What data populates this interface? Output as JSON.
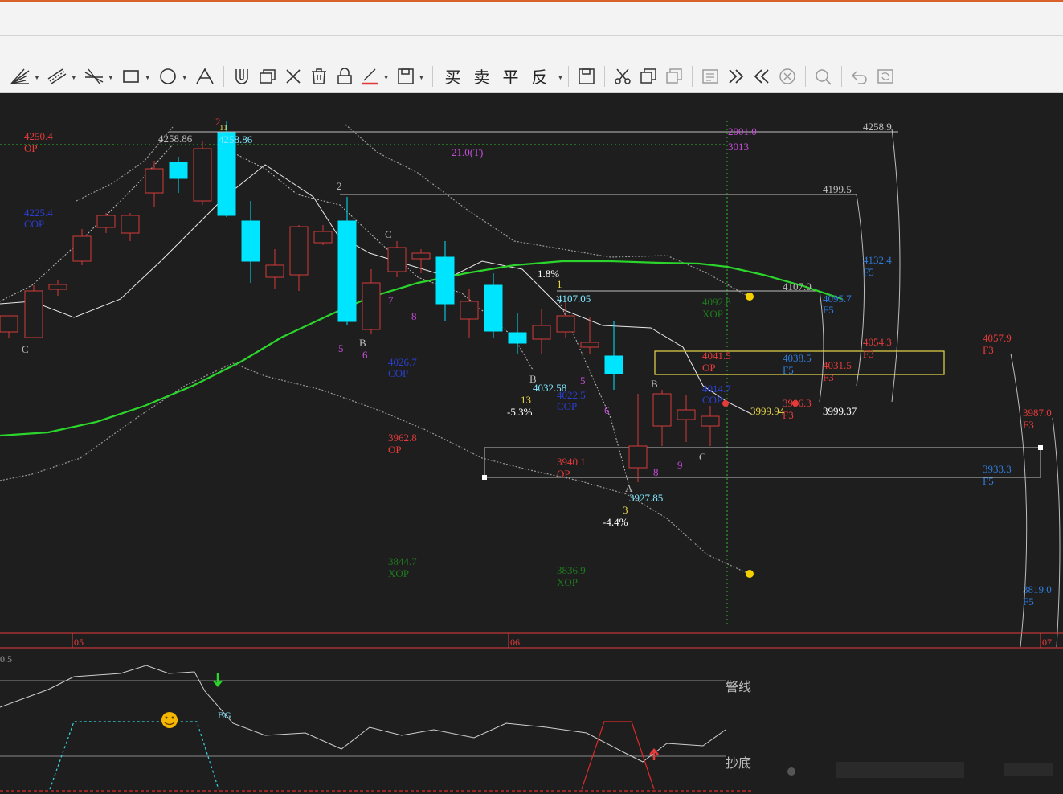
{
  "toolbar": {
    "tools": [
      {
        "name": "fan-lines-tool-icon",
        "caret": true
      },
      {
        "name": "parallel-lines-tool-icon",
        "caret": true
      },
      {
        "name": "cross-lines-tool-icon",
        "caret": true
      },
      {
        "name": "rectangle-tool-icon",
        "caret": true
      },
      {
        "name": "ellipse-tool-icon",
        "caret": true
      },
      {
        "name": "text-tool-icon",
        "caret": false
      }
    ],
    "trade_buttons": [
      "买",
      "卖",
      "平",
      "反"
    ]
  },
  "axis": {
    "x_labels": [
      "05",
      "06",
      "07"
    ]
  },
  "indicator": {
    "top_value": "0.5",
    "warning_label": "警线",
    "bottom_label": "抄底",
    "bg_label": "BG"
  },
  "price_labels": {
    "p4250": "4250.4",
    "op": "OP",
    "p4225": "4225.4",
    "cop": "COP",
    "p4258a": "4258.86",
    "p4258b": "4258.86",
    "t21": "21.0(T)",
    "p2001": "2001.0",
    "p3013": "3013",
    "p4258top": "4258.9",
    "p4199": "4199.5",
    "p4132": "4132.4",
    "f5": "F5",
    "f3": "F3",
    "p4107": "4107.0",
    "p4095": "4095.7",
    "p4092": "4092.8",
    "xop": "XOP",
    "p4107b": "4107.05",
    "pct18": "1.8%",
    "p4054": "4054.3",
    "p4057": "4057.9",
    "p4041": "4041.5",
    "p4038": "4038.5",
    "p4031": "4031.5",
    "p4026": "4026.7",
    "p4032": "4032.58",
    "p4022": "4022.5",
    "p4014": "4014.7",
    "p3996": "3996.3",
    "p3999a": "3999.94",
    "p3999b": "3999.37",
    "p3987": "3987.0",
    "p3962": "3962.8",
    "pct53": "-5.3%",
    "n13": "13",
    "p3940": "3940.1",
    "p3933": "3933.3",
    "p3927": "3927.85",
    "pct44": "-4.4%",
    "n3": "3",
    "p3844": "3844.7",
    "p3836": "3836.9",
    "p3819": "3819.0"
  },
  "marks": {
    "c1": "C",
    "b1": "B",
    "c2": "C",
    "b2": "B",
    "b3": "B",
    "c3": "C",
    "a1": "A",
    "n5a": "5",
    "n6a": "6",
    "n7": "7",
    "n8a": "8",
    "n5b": "5",
    "n6b": "6",
    "n8b": "8",
    "n9": "9",
    "n1": "1",
    "n2a": "2",
    "n2b": "2",
    "n11": "11"
  },
  "colors": {
    "bg": "#1e1e1e",
    "up": "#d43a3a",
    "down": "#00e5ff",
    "ma": "#2bd52b",
    "red": "#e53b3b",
    "blue": "#2f7bd8",
    "green": "#1f7a1f",
    "magenta": "#c44dd8",
    "yellow": "#e8d84a"
  }
}
